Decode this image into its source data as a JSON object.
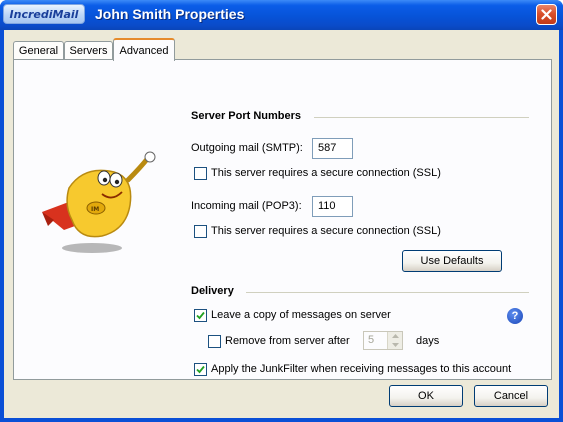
{
  "window": {
    "logo_text": "IncrediMail",
    "title": "John Smith Properties"
  },
  "tabs": [
    {
      "label": "General"
    },
    {
      "label": "Servers"
    },
    {
      "label": "Advanced"
    }
  ],
  "server_ports": {
    "heading": "Server Port Numbers",
    "outgoing_label": "Outgoing mail (SMTP):",
    "outgoing_value": "587",
    "outgoing_ssl_label": "This server requires a secure connection (SSL)",
    "outgoing_ssl_checked": false,
    "incoming_label": "Incoming mail (POP3):",
    "incoming_value": "110",
    "incoming_ssl_label": "This server requires a secure connection (SSL)",
    "incoming_ssl_checked": false,
    "use_defaults_label": "Use Defaults"
  },
  "delivery": {
    "heading": "Delivery",
    "leave_copy_label": "Leave a copy of messages on server",
    "leave_copy_checked": true,
    "remove_after_label": "Remove from server after",
    "remove_after_checked": false,
    "remove_after_days": "5",
    "days_label": "days",
    "junkfilter_label": "Apply the JunkFilter when receiving messages to this account",
    "junkfilter_checked": true
  },
  "footer": {
    "ok_label": "OK",
    "cancel_label": "Cancel"
  }
}
